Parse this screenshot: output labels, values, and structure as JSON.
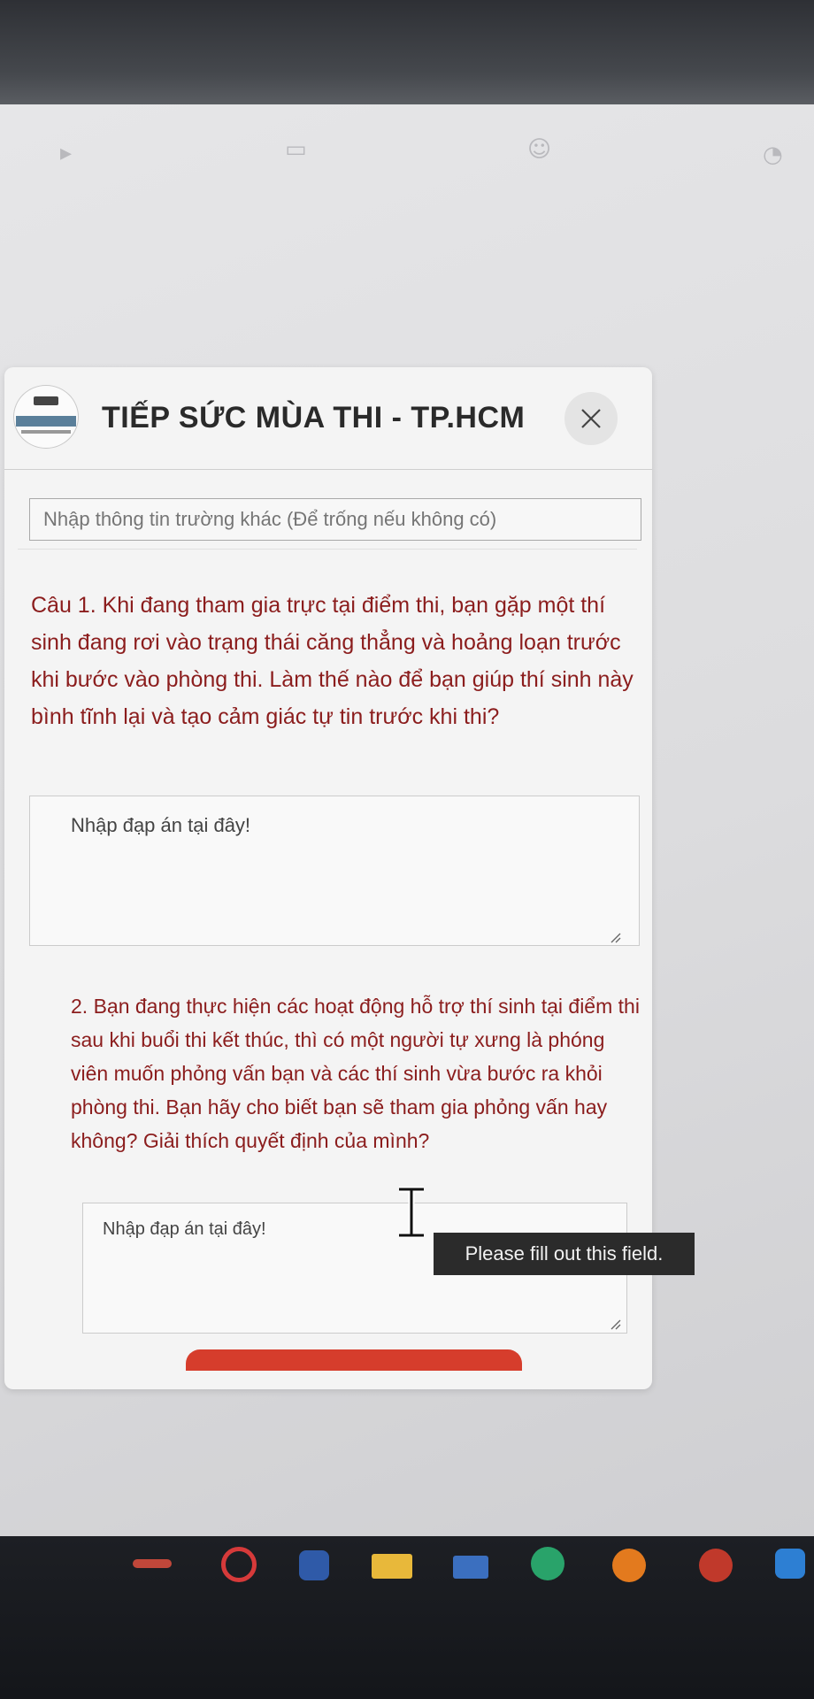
{
  "dialog": {
    "title": "TIẾP SỨC MÙA THI - TP.HCM",
    "close_label": "✕"
  },
  "school_field": {
    "placeholder": "Nhập thông tin trường khác (Để trống nếu không có)"
  },
  "question1": {
    "text": "Câu 1. Khi đang tham gia trực tại điểm thi, bạn gặp một thí sinh đang rơi vào trạng thái căng thẳng và hoảng loạn trước khi bước vào phòng thi. Làm thế nào để bạn giúp thí sinh này bình tĩnh lại và tạo cảm giác tự tin trước khi thi?",
    "answer_placeholder": "Nhập đạp án tại đây!"
  },
  "question2": {
    "text": "2. Bạn đang thực hiện các hoạt động hỗ trợ thí sinh tại điểm thi sau khi buổi thi kết thúc, thì có một người tự xưng là phóng viên muốn phỏng vấn bạn và các thí sinh vừa bước ra khỏi phòng thi. Bạn hãy cho biết bạn sẽ tham gia phỏng vấn hay không? Giải thích quyết định của mình?",
    "answer_placeholder": "Nhập đạp án tại đây!"
  },
  "validation": {
    "tooltip": "Please fill out this field."
  },
  "background_icons": [
    "play-icon",
    "store-icon",
    "group-icon",
    "chat-icon"
  ],
  "taskbar": {
    "icons": [
      "app-icon",
      "search-icon",
      "word-icon",
      "folder-icon",
      "mail-icon",
      "edge-icon",
      "firefox-icon",
      "zalo-icon",
      "store-icon"
    ]
  },
  "colors": {
    "question_text": "#8b1d1d",
    "submit_button": "#d63d2c",
    "tooltip_bg": "#2b2b2b"
  }
}
